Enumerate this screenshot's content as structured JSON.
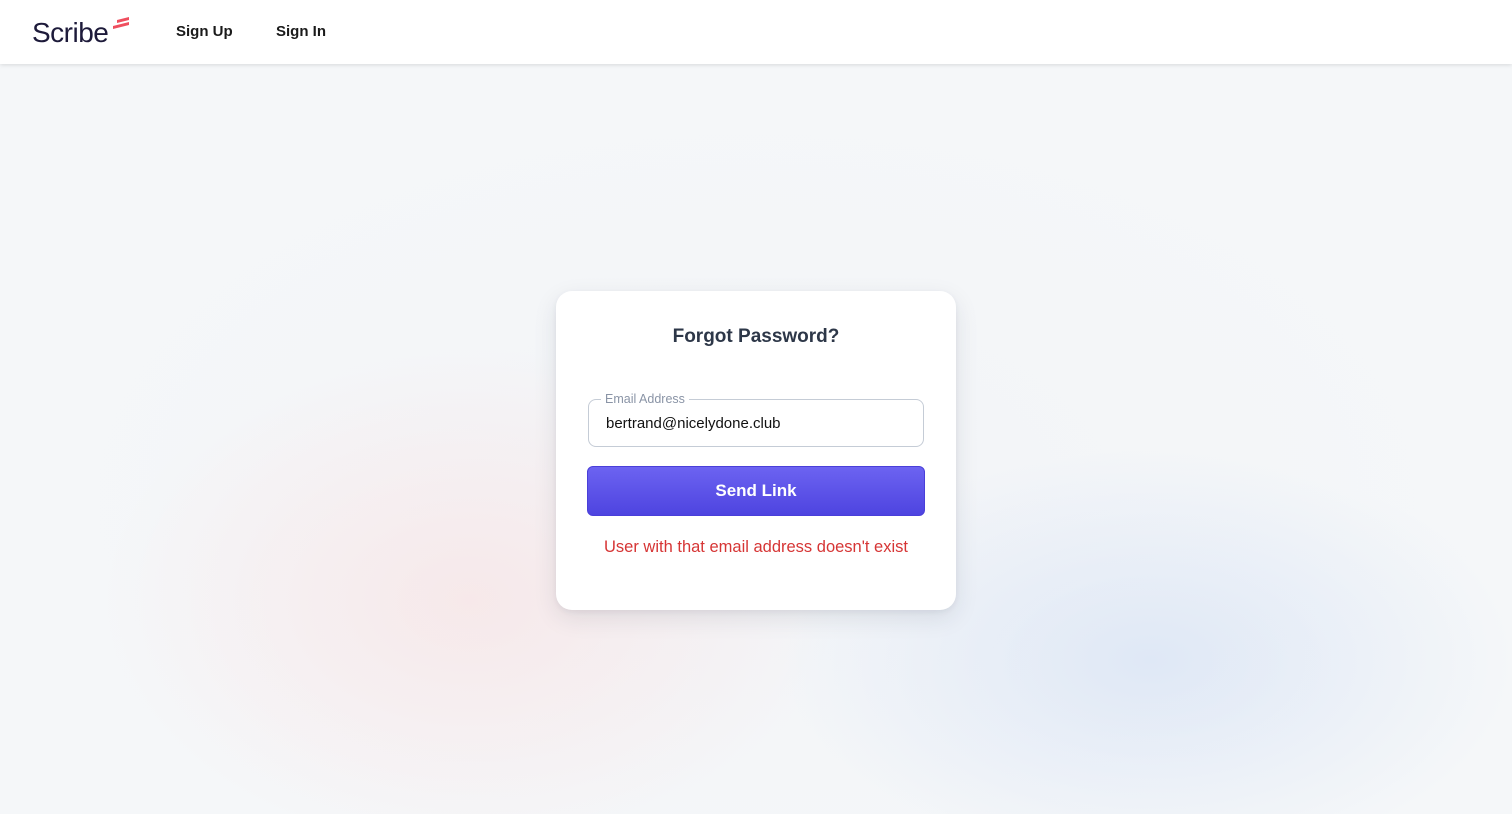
{
  "header": {
    "logo_text": "Scribe",
    "nav": {
      "sign_up": "Sign Up",
      "sign_in": "Sign In"
    }
  },
  "card": {
    "title": "Forgot Password?",
    "email_field": {
      "label": "Email Address",
      "value": "bertrand@nicelydone.club"
    },
    "send_button_label": "Send Link",
    "error_message": "User with that email address doesn't exist"
  },
  "colors": {
    "brand_dark": "#1d1a3a",
    "logo_accent": "#ef4e5e",
    "button_primary": "#5b52ea",
    "error": "#d63535"
  },
  "icons": {
    "logo_mark": "scribe-stripes-mark"
  }
}
